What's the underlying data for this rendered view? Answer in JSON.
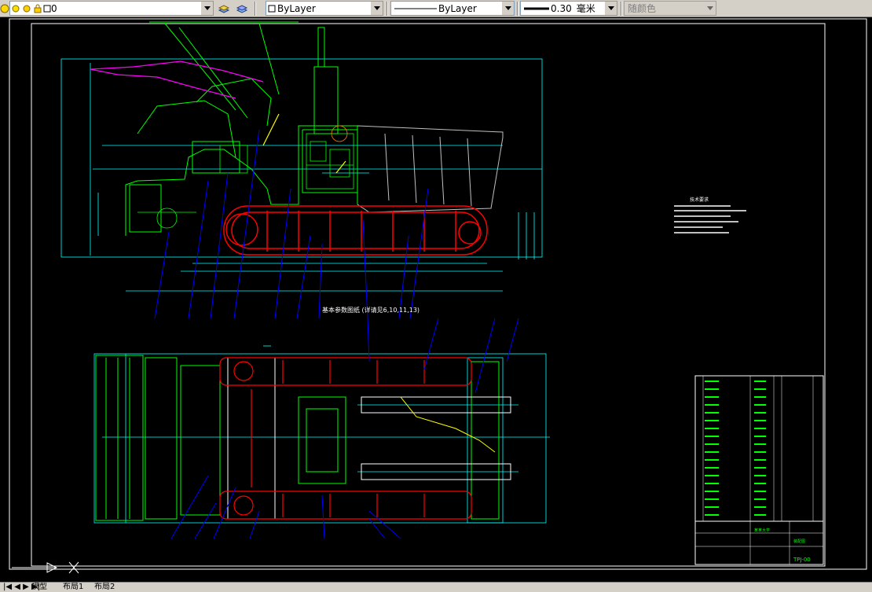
{
  "toolbar": {
    "layer_name": "0",
    "linetype": "ByLayer",
    "color_prop": "ByLayer",
    "lineweight_value": "0.30",
    "lineweight_unit": "毫米",
    "plotstyle": "随颜色"
  },
  "drawing": {
    "tech_req_title": "技术要求",
    "section_label": "基本参数图纸 (详请见6,10,11,13)",
    "drawing_number": "TPJ-00",
    "title_block_company": "某某大学",
    "title_block_name": "装配图"
  },
  "status_tabs": [
    "模型",
    "布局1",
    "布局2"
  ],
  "colors": {
    "green": "#00ff00",
    "red": "#ff0000",
    "cyan": "#00ffff",
    "white": "#ffffff",
    "yellow": "#ffff00",
    "blue": "#0000ff",
    "magenta": "#ff00ff"
  }
}
